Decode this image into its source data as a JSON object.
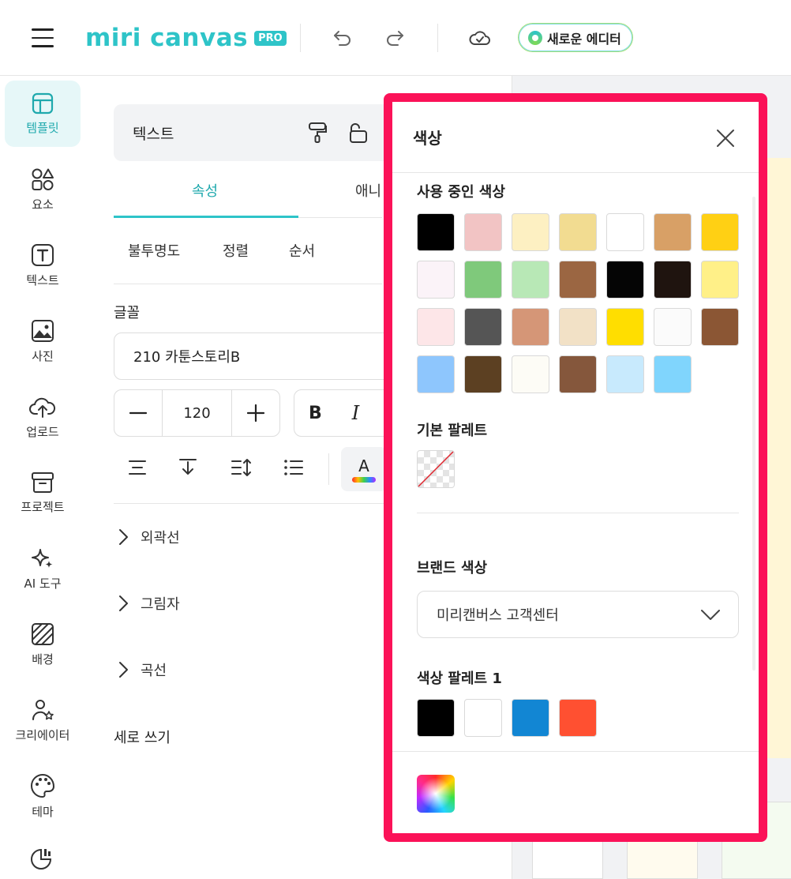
{
  "topbar": {
    "brand_name": "miri canvas",
    "brand_badge": "PRO",
    "new_editor_label": "새로운 에디터"
  },
  "rail": {
    "items": [
      {
        "label": "템플릿",
        "icon": "template-icon",
        "active": true
      },
      {
        "label": "요소",
        "icon": "elements-icon"
      },
      {
        "label": "텍스트",
        "icon": "text-icon"
      },
      {
        "label": "사진",
        "icon": "photo-icon"
      },
      {
        "label": "업로드",
        "icon": "upload-cloud-icon"
      },
      {
        "label": "프로젝트",
        "icon": "archive-box-icon"
      },
      {
        "label": "AI 도구",
        "icon": "sparkle-icon"
      },
      {
        "label": "배경",
        "icon": "background-pattern-icon"
      },
      {
        "label": "크리에이터",
        "icon": "creator-user-icon"
      },
      {
        "label": "테마",
        "icon": "palette-icon"
      }
    ]
  },
  "panel": {
    "header_title": "텍스트",
    "tabs": [
      "속성",
      "애니"
    ],
    "active_tab": "속성",
    "subtabs": [
      "불투명도",
      "정렬",
      "순서"
    ],
    "font_label": "글꼴",
    "font_value": "210 카툰스토리B",
    "size_value": "120",
    "bold_label": "B",
    "italic_label": "I",
    "color_label": "A",
    "expanders": [
      "외곽선",
      "그림자",
      "곡선"
    ],
    "vertical_writing_label": "세로 쓰기"
  },
  "color_popup": {
    "title": "색상",
    "used_colors_label": "사용 중인 색상",
    "used_colors": [
      "#000000",
      "#f2c4c4",
      "#fdf0c2",
      "#f2dc91",
      "#ffffff",
      "#d8a066",
      "#ffd014",
      "#fbf3f8",
      "#7fc97b",
      "#b8e8b6",
      "#9b6642",
      "#050505",
      "#1f140f",
      "#fff088",
      "#fde6e8",
      "#555555",
      "#d59677",
      "#f2e1c6",
      "#ffde00",
      "#fbfbfb",
      "#8b5634",
      "#8ec6fd",
      "#5c4022",
      "#fdfcf6",
      "#85573c",
      "#c8eafd",
      "#80d5fd"
    ],
    "default_palette_label": "기본 팔레트",
    "brand_colors_label": "브랜드 색상",
    "brand_select_value": "미리캔버스 고객센터",
    "palette1_label": "색상 팔레트 1",
    "palette1_colors": [
      "#000000",
      "#ffffff",
      "#1286d3",
      "#ff5031"
    ]
  }
}
